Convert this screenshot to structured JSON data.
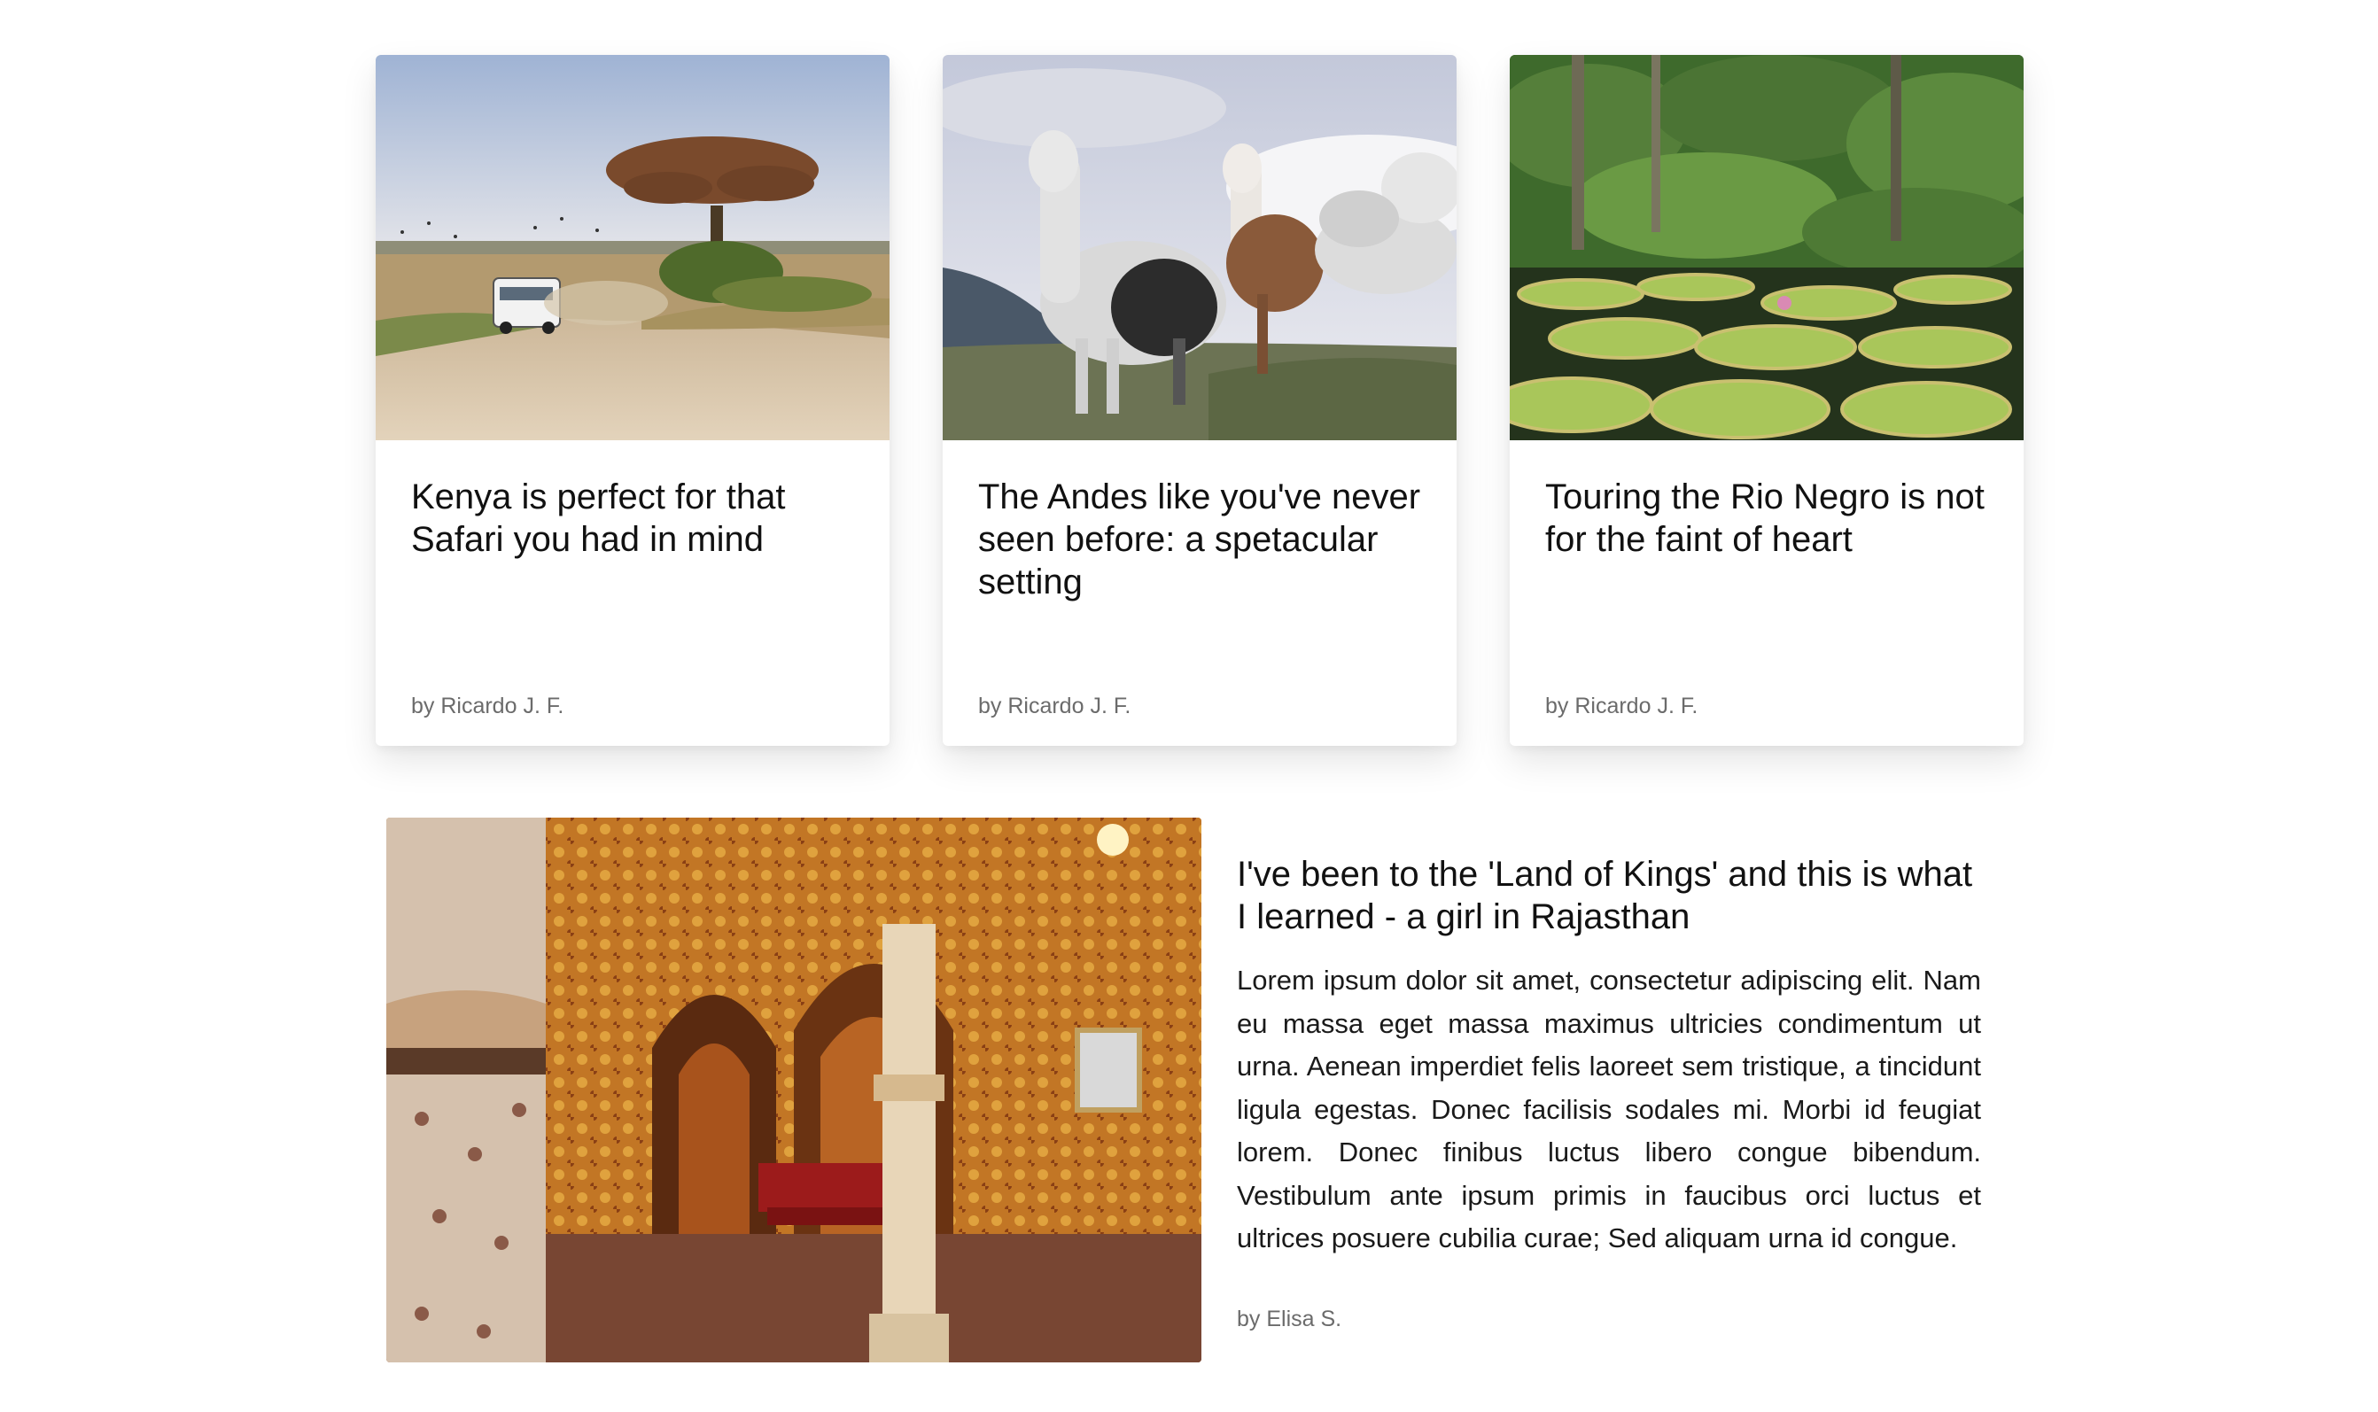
{
  "cards": [
    {
      "title": "Kenya is perfect for that Safari you had in mind",
      "author": "by Ricardo J. F."
    },
    {
      "title": "The Andes like you've never seen before: a spetacular setting",
      "author": "by Ricardo J. F."
    },
    {
      "title": "Touring the Rio Negro is not for the faint of heart",
      "author": "by Ricardo J. F."
    }
  ],
  "feature": {
    "title": "I've been to the 'Land of Kings' and this is what I learned - a girl in Rajasthan",
    "body": "Lorem ipsum dolor sit amet, consectetur adipiscing elit. Nam eu massa eget massa maximus ultricies condimentum ut urna. Aenean imperdiet felis laoreet sem tristique, a tincidunt ligula egestas. Donec facilisis sodales mi. Morbi id feugiat lorem. Donec finibus luctus libero congue bibendum. Vestibulum ante ipsum primis in faucibus orci luctus et ultrices posuere cubilia curae; Sed aliquam urna id congue.",
    "author": "by Elisa S."
  }
}
